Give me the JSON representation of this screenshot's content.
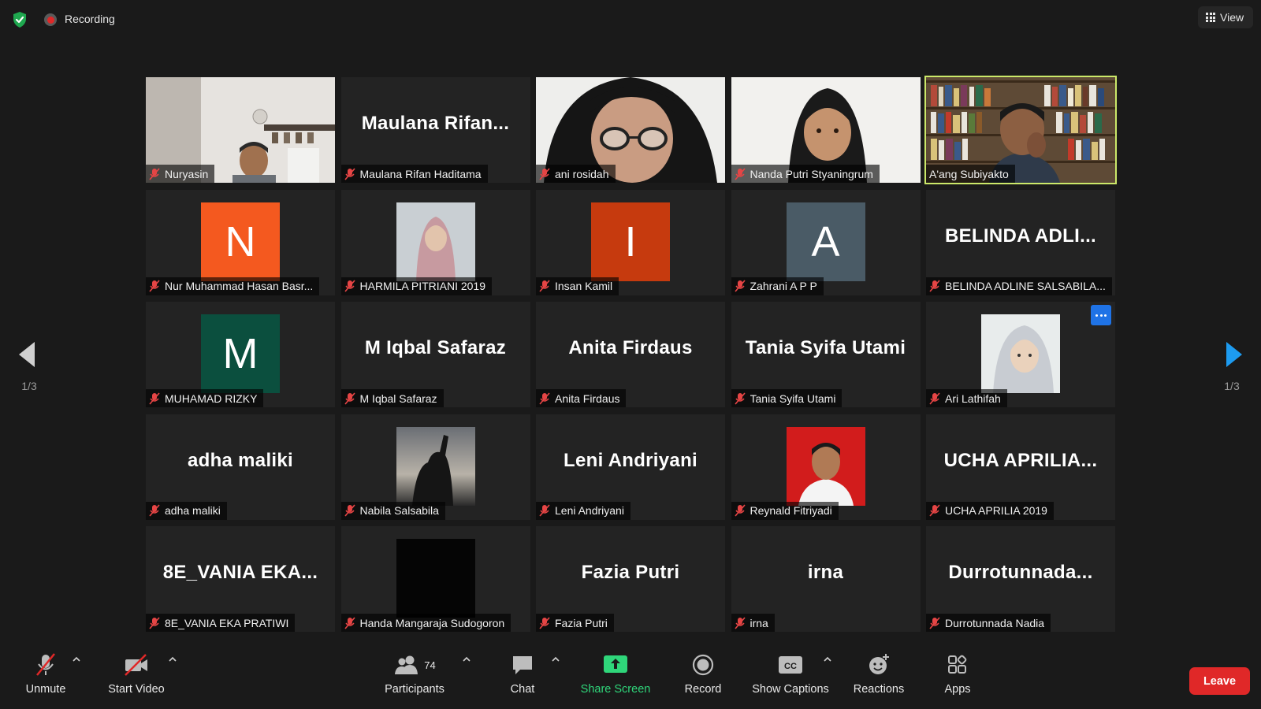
{
  "top_bar": {
    "recording_label": "Recording",
    "view_label": "View"
  },
  "pagination": {
    "prev_indicator": "1/3",
    "next_indicator": "1/3"
  },
  "participants": [
    {
      "name": "Nuryasin",
      "display": "video"
    },
    {
      "name": "Maulana Rifan Haditama",
      "display": "name",
      "big_name": "Maulana  Rifan..."
    },
    {
      "name": "ani rosidah",
      "display": "video"
    },
    {
      "name": "Nanda Putri Styaningrum",
      "display": "video"
    },
    {
      "name": "A'ang Subiyakto",
      "display": "video",
      "active_speaker": true
    },
    {
      "name": "Nur Muhammad Hasan Basr...",
      "display": "avatar",
      "avatar_letter": "N",
      "avatar_color": "#f4591f"
    },
    {
      "name": "HARMILA PITRIANI 2019",
      "display": "photo"
    },
    {
      "name": "Insan Kamil",
      "display": "avatar",
      "avatar_letter": "I",
      "avatar_color": "#c63a0e"
    },
    {
      "name": "Zahrani A P P",
      "display": "avatar",
      "avatar_letter": "A",
      "avatar_color": "#4a5b66"
    },
    {
      "name": "BELINDA ADLINE SALSABILA...",
      "display": "name",
      "big_name": "BELINDA  ADLI..."
    },
    {
      "name": "MUHAMAD RIZKY",
      "display": "avatar",
      "avatar_letter": "M",
      "avatar_color": "#0b4f3e"
    },
    {
      "name": "M Iqbal Safaraz",
      "display": "name",
      "big_name": "M Iqbal Safaraz"
    },
    {
      "name": "Anita Firdaus",
      "display": "name",
      "big_name": "Anita Firdaus"
    },
    {
      "name": "Tania Syifa Utami",
      "display": "name",
      "big_name": "Tania Syifa Utami"
    },
    {
      "name": "Ari Lathifah",
      "display": "photo",
      "has_more_button": true
    },
    {
      "name": "adha maliki",
      "display": "name",
      "big_name": "adha maliki"
    },
    {
      "name": "Nabila Salsabila",
      "display": "photo"
    },
    {
      "name": "Leni Andriyani",
      "display": "name",
      "big_name": "Leni Andriyani"
    },
    {
      "name": "Reynald Fitriyadi",
      "display": "photo"
    },
    {
      "name": "UCHA APRILIA 2019",
      "display": "name",
      "big_name": "UCHA  APRILIA..."
    },
    {
      "name": "8E_VANIA EKA PRATIWI",
      "display": "name",
      "big_name": "8E_VANIA  EKA..."
    },
    {
      "name": "Handa Mangaraja Sudogoron",
      "display": "photo"
    },
    {
      "name": "Fazia Putri",
      "display": "name",
      "big_name": "Fazia Putri"
    },
    {
      "name": "irna",
      "display": "name",
      "big_name": "irna"
    },
    {
      "name": "Durrotunnada Nadia",
      "display": "name",
      "big_name": "Durrotunnada..."
    }
  ],
  "toolbar": {
    "unmute": "Unmute",
    "start_video": "Start Video",
    "participants": "Participants",
    "participants_count": "74",
    "chat": "Chat",
    "share_screen": "Share Screen",
    "record": "Record",
    "show_captions": "Show Captions",
    "reactions": "Reactions",
    "apps": "Apps",
    "leave": "Leave"
  },
  "colors": {
    "background": "#1a1a1a",
    "active_speaker_border": "#cbe869",
    "share_green": "#2fd67a",
    "leave_red": "#e02828",
    "nav_blue": "#1d9bf0"
  }
}
